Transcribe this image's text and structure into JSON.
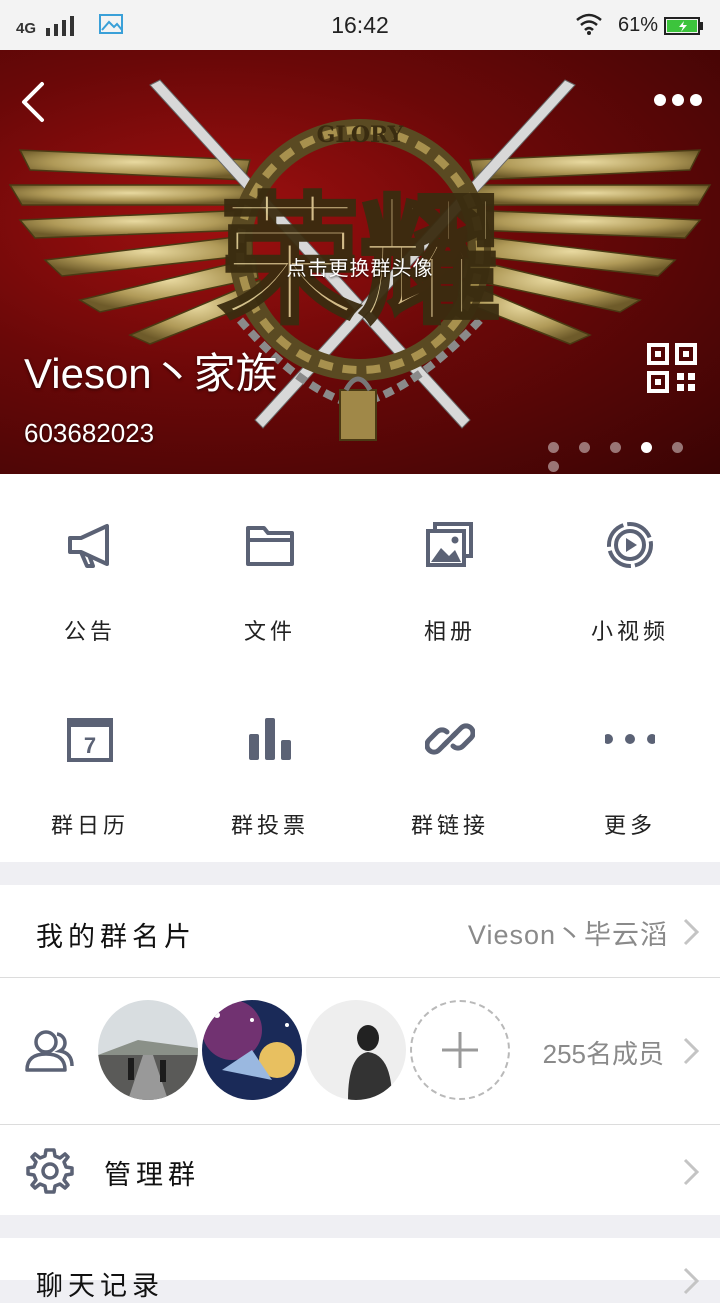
{
  "status_bar": {
    "network": "4G",
    "time": "16:42",
    "battery": "61%"
  },
  "header": {
    "change_avatar": "点击更换群头像",
    "group_name": "Vieson丶家族",
    "group_id": "603682023",
    "page_dots": 6,
    "active_dot": 3,
    "logo_text": "GLORY"
  },
  "functions": [
    {
      "label": "公告",
      "icon": "megaphone-icon"
    },
    {
      "label": "文件",
      "icon": "folder-icon"
    },
    {
      "label": "相册",
      "icon": "photo-album-icon"
    },
    {
      "label": "小视频",
      "icon": "video-play-icon"
    },
    {
      "label": "群日历",
      "icon": "calendar-icon"
    },
    {
      "label": "群投票",
      "icon": "bar-chart-icon"
    },
    {
      "label": "群链接",
      "icon": "link-icon"
    },
    {
      "label": "更多",
      "icon": "more-dots-icon"
    }
  ],
  "my_card": {
    "label": "我的群名片",
    "value": "Vieson丶毕云滔"
  },
  "members": {
    "count": "255名成员"
  },
  "manage": {
    "label": "管理群"
  },
  "chat_history": {
    "label": "聊天记录"
  },
  "colors": {
    "icon": "#5b6275",
    "banner": "#8a0d0d",
    "chevron": "#c4c4c4"
  }
}
